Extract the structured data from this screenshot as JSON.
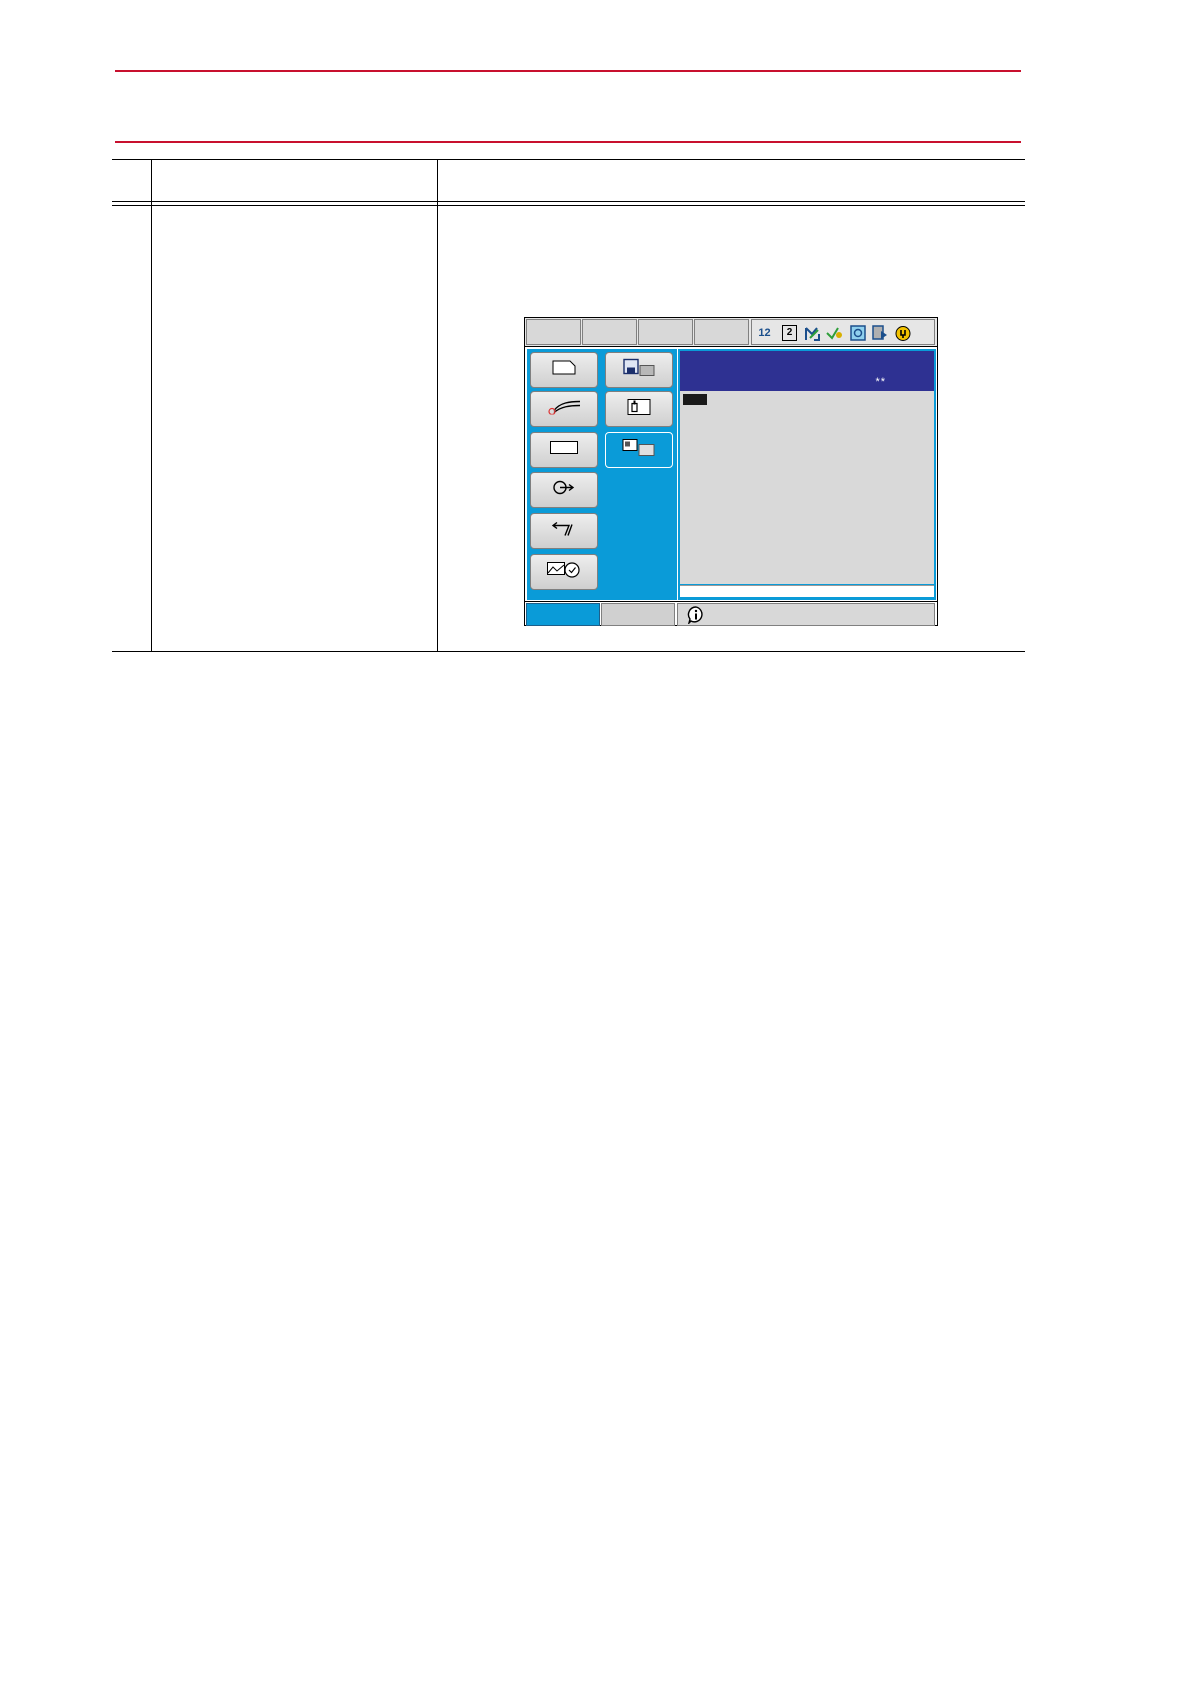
{
  "header": {
    "rule_color": "#c8102e"
  },
  "procedure_table": {
    "columns": [
      "",
      "",
      ""
    ],
    "rows": [
      {
        "step": "",
        "operation": "",
        "explanation": ""
      }
    ]
  },
  "pendant": {
    "colors": {
      "menu_panel": "#0a9bd8",
      "content_header": "#2e3192",
      "content_body": "#d9d9d9",
      "button_face": "#dcdcdc"
    },
    "top_tabs": [
      "",
      "",
      "",
      ""
    ],
    "status_icons": [
      "digits-icon",
      "page-two-icon",
      "robot-arm-icon",
      "coord-icon",
      "teach-icon",
      "play-icon",
      "security-icon"
    ],
    "status_icon_text": {
      "digits": "12",
      "page": "2"
    },
    "main_menu": [
      {
        "icon": "job-icon",
        "label": ""
      },
      {
        "icon": "arc-welding-icon",
        "label": ""
      },
      {
        "icon": "variable-icon",
        "label": ""
      },
      {
        "icon": "in-out-icon",
        "label": ""
      },
      {
        "icon": "robot-icon",
        "label": ""
      },
      {
        "icon": "system-info-icon",
        "label": ""
      }
    ],
    "sub_menu": [
      {
        "icon": "file-save-icon",
        "label": ""
      },
      {
        "icon": "setup-icon",
        "label": ""
      },
      {
        "icon": "display-setup-icon",
        "label": "",
        "active": true
      }
    ],
    "content": {
      "title": "",
      "header_marks": "**",
      "input_value": ""
    },
    "bottom_bar": {
      "main_menu_label": "",
      "simple_menu_label": "",
      "message": ""
    }
  }
}
